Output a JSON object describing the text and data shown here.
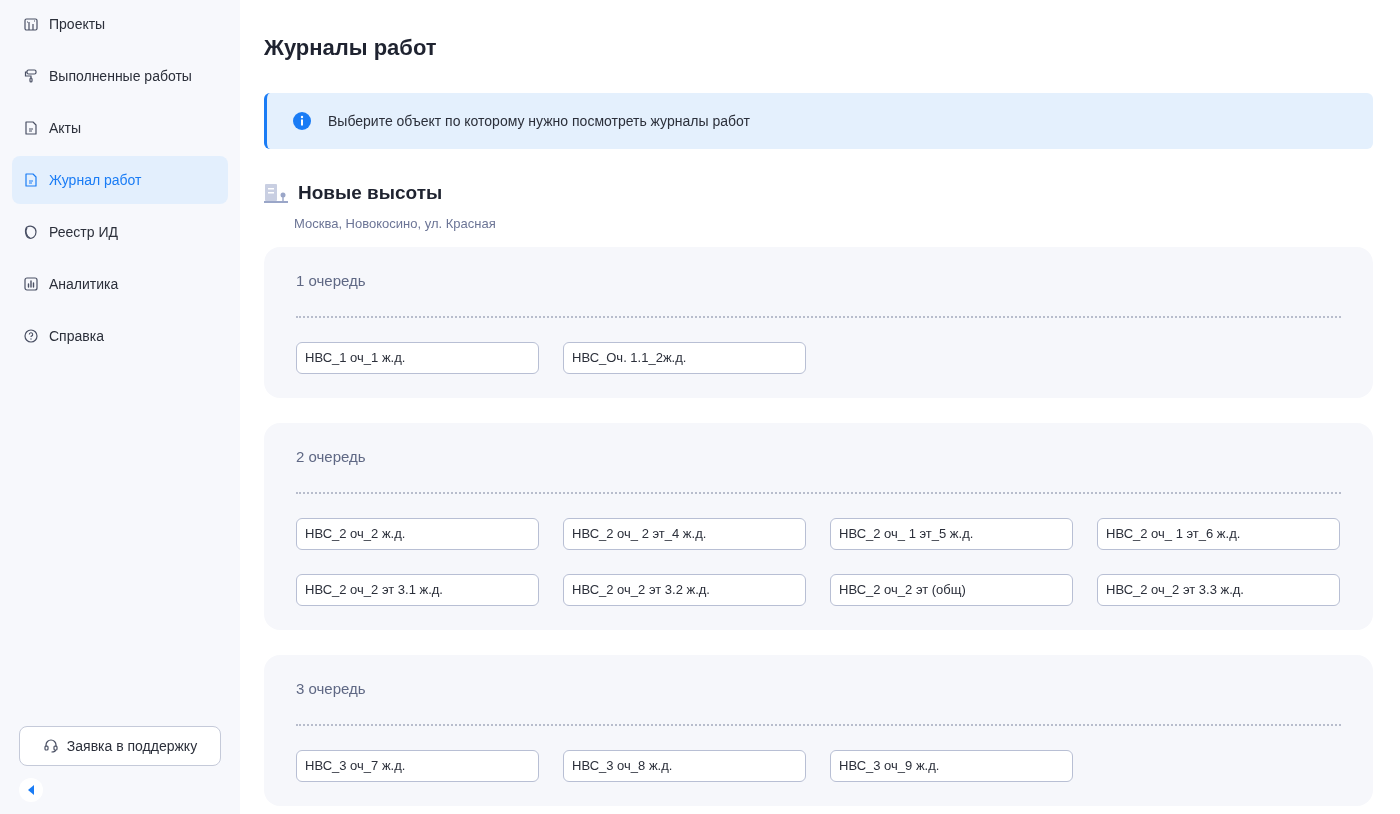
{
  "sidebar": {
    "items": [
      {
        "label": "Проекты",
        "selected": false
      },
      {
        "label": "Выполненные работы",
        "selected": false
      },
      {
        "label": "Акты",
        "selected": false
      },
      {
        "label": "Журнал работ",
        "selected": true
      },
      {
        "label": "Реестр ИД",
        "selected": false
      },
      {
        "label": "Аналитика",
        "selected": false
      },
      {
        "label": "Справка",
        "selected": false
      }
    ],
    "support_button": "Заявка в поддержку"
  },
  "page": {
    "title": "Журналы работ",
    "info_banner": "Выберите объект по которому нужно посмотреть журналы работ",
    "object": {
      "name": "Новые высоты",
      "address": "Москва, Новокосино, ул. Красная"
    },
    "groups": [
      {
        "title": "1 очередь",
        "journals": [
          "НВС_1 оч_1 ж.д.",
          "НВС_Оч. 1.1_2ж.д."
        ]
      },
      {
        "title": "2 очередь",
        "journals": [
          "НВС_2 оч_2 ж.д.",
          "НВС_2 оч_ 2 эт_4 ж.д.",
          "НВС_2 оч_ 1 эт_5 ж.д.",
          "НВС_2 оч_ 1 эт_6 ж.д.",
          "НВС_2 оч_2 эт 3.1 ж.д.",
          "НВС_2 оч_2 эт 3.2 ж.д.",
          "НВС_2 оч_2 эт (общ)",
          "НВС_2 оч_2 эт 3.3 ж.д."
        ]
      },
      {
        "title": "3 очередь",
        "journals": [
          "НВС_3 оч_7 ж.д.",
          "НВС_3 оч_8 ж.д.",
          "НВС_3 оч_9 ж.д."
        ]
      }
    ]
  }
}
